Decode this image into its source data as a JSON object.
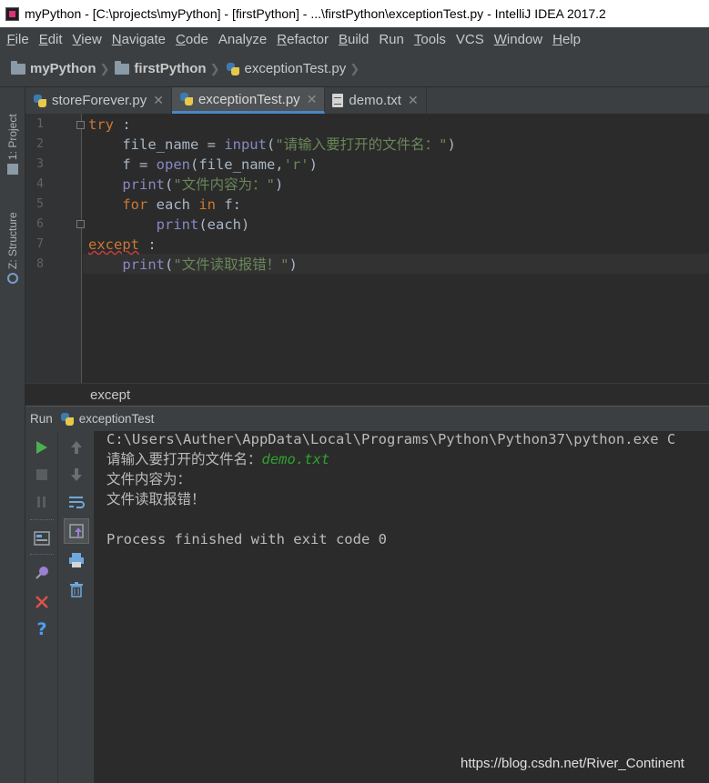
{
  "window": {
    "title": "myPython - [C:\\projects\\myPython] - [firstPython] - ...\\firstPython\\exceptionTest.py - IntelliJ IDEA 2017.2"
  },
  "menu": [
    {
      "mnemonic": "F",
      "rest": "ile"
    },
    {
      "mnemonic": "E",
      "rest": "dit"
    },
    {
      "mnemonic": "V",
      "rest": "iew"
    },
    {
      "mnemonic": "N",
      "rest": "avigate"
    },
    {
      "mnemonic": "C",
      "rest": "ode"
    },
    {
      "mnemonic": "",
      "rest": "Analyze"
    },
    {
      "mnemonic": "R",
      "rest": "efactor"
    },
    {
      "mnemonic": "B",
      "rest": "uild"
    },
    {
      "mnemonic": "",
      "rest": "Run"
    },
    {
      "mnemonic": "T",
      "rest": "ools"
    },
    {
      "mnemonic": "",
      "rest": "VCS"
    },
    {
      "mnemonic": "W",
      "rest": "indow"
    },
    {
      "mnemonic": "H",
      "rest": "elp"
    }
  ],
  "navbar": {
    "project": "myPython",
    "module": "firstPython",
    "file": "exceptionTest.py"
  },
  "side_tabs": {
    "project": "1: Project",
    "structure": "Z: Structure"
  },
  "tabs": [
    {
      "label": "storeForever.py",
      "icon": "python-file-icon"
    },
    {
      "label": "exceptionTest.py",
      "icon": "python-file-icon",
      "active": true
    },
    {
      "label": "demo.txt",
      "icon": "text-file-icon"
    }
  ],
  "editor": {
    "line_numbers": [
      "1",
      "2",
      "3",
      "4",
      "5",
      "6",
      "7",
      "8"
    ],
    "code": {
      "l1_kw": "try",
      "l1_rest": " :",
      "l2_a": "    file_name = ",
      "l2_fn": "input",
      "l2_b": "(",
      "l2_str": "\"请输入要打开的文件名：\"",
      "l2_c": ")",
      "l3_a": "    f = ",
      "l3_fn": "open",
      "l3_b": "(file_name,",
      "l3_str": "'r'",
      "l3_c": ")",
      "l4_fn": "print",
      "l4_b": "(",
      "l4_str": "\"文件内容为：\"",
      "l4_c": ")",
      "l5_kw1": "for",
      "l5_a": " each ",
      "l5_kw2": "in",
      "l5_b": " f:",
      "l6_fn": "print",
      "l6_b": "(each)",
      "l7_kw": "except",
      "l7_rest": " :",
      "l8_fn": "print",
      "l8_b": "(",
      "l8_str": "\"文件读取报错！\"",
      "l8_c": ")"
    },
    "breadcrumb": "except"
  },
  "run_panel": {
    "label": "Run",
    "config": "exceptionTest",
    "console": {
      "line1": "C:\\Users\\Auther\\AppData\\Local\\Programs\\Python\\Python37\\python.exe C",
      "line2_prompt": "请输入要打开的文件名：",
      "line2_input": "demo.txt",
      "line3": "文件内容为：",
      "line4": "文件读取报错！",
      "line6": "Process finished with exit code 0"
    }
  },
  "watermark": "https://blog.csdn.net/River_Continent",
  "colors": {
    "keyword": "#cc7832",
    "builtin": "#8888c6",
    "string": "#6a8759",
    "run_green": "#4caf50",
    "stop_red": "#d9534f",
    "accent_blue": "#4a88c7"
  }
}
